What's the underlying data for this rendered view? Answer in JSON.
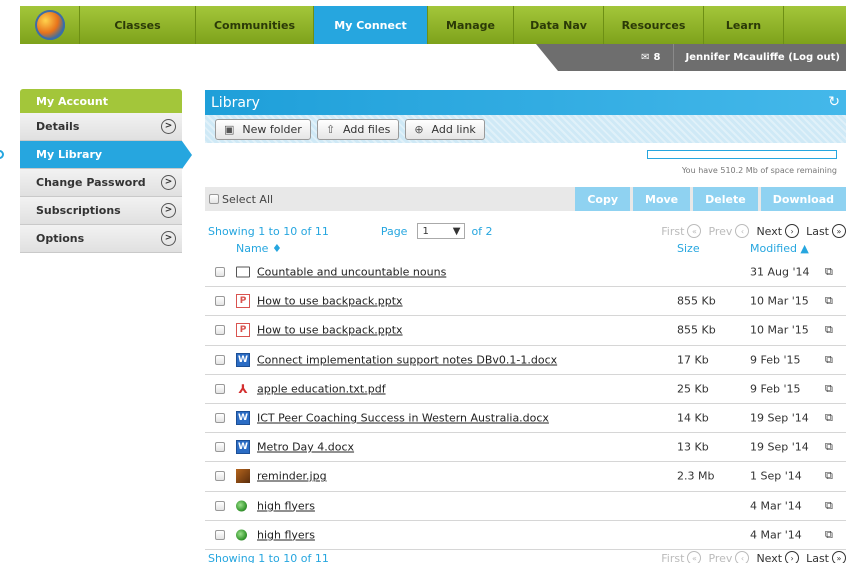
{
  "nav": {
    "tabs": [
      {
        "label": "Classes",
        "width": 0
      },
      {
        "label": "Communities"
      },
      {
        "label": "My Connect",
        "active": true
      },
      {
        "label": "Manage"
      },
      {
        "label": "Data Nav"
      },
      {
        "label": "Resources"
      },
      {
        "label": "Learn"
      }
    ]
  },
  "userbar": {
    "message_count": "8",
    "user_text": "Jennifer Mcauliffe (Log out)"
  },
  "sidebar": {
    "header": "My Account",
    "items": [
      {
        "label": "Details"
      },
      {
        "label": "My Library",
        "active": true
      },
      {
        "label": "Change Password"
      },
      {
        "label": "Subscriptions"
      },
      {
        "label": "Options"
      }
    ]
  },
  "library": {
    "title": "Library",
    "toolbar": {
      "new_folder": "New folder",
      "add_files": "Add files",
      "add_link": "Add link"
    },
    "quota_text": "You have 510.2 Mb of space remaining",
    "select_all": "Select All",
    "actions": [
      "Copy",
      "Move",
      "Delete",
      "Download"
    ],
    "pager": {
      "showing": "Showing 1 to 10 of 11",
      "page_label": "Page",
      "page_value": "1",
      "of_pages": "of 2",
      "first": "First",
      "prev": "Prev",
      "next": "Next",
      "last": "Last"
    },
    "columns": {
      "name": "Name ♦",
      "size": "Size",
      "modified": "Modified ▲"
    },
    "files": [
      {
        "icon": "folder-icon",
        "name": "Countable and uncountable nouns",
        "size": "",
        "modified": "31 Aug '14"
      },
      {
        "icon": "ppt-icon",
        "name": "How to use backpack.pptx",
        "size": "855 Kb",
        "modified": "10 Mar '15"
      },
      {
        "icon": "ppt-icon",
        "name": "How to use backpack.pptx",
        "size": "855 Kb",
        "modified": "10 Mar '15"
      },
      {
        "icon": "word-doc-icon",
        "name": "Connect implementation support notes DBv0.1-1.docx",
        "size": "17 Kb",
        "modified": "9 Feb '15"
      },
      {
        "icon": "pdf-icon",
        "name": "apple education.txt.pdf",
        "size": "25 Kb",
        "modified": "9 Feb '15"
      },
      {
        "icon": "word-doc-icon",
        "name": "ICT Peer Coaching Success in Western Australia.docx",
        "size": "14 Kb",
        "modified": "19 Sep '14"
      },
      {
        "icon": "word-doc-icon",
        "name": "Metro Day 4.docx",
        "size": "13 Kb",
        "modified": "19 Sep '14"
      },
      {
        "icon": "image-icon",
        "name": "reminder.jpg",
        "size": "2.3 Mb",
        "modified": "1 Sep '14"
      },
      {
        "icon": "web-link-icon",
        "name": "high flyers",
        "size": "",
        "modified": "4 Mar '14"
      },
      {
        "icon": "web-link-icon",
        "name": "high flyers",
        "size": "",
        "modified": "4 Mar '14"
      }
    ]
  },
  "colors": {
    "brand_green": "#a3c63a",
    "accent_blue": "#26a6df",
    "action_disabled": "#8fd2f1"
  }
}
